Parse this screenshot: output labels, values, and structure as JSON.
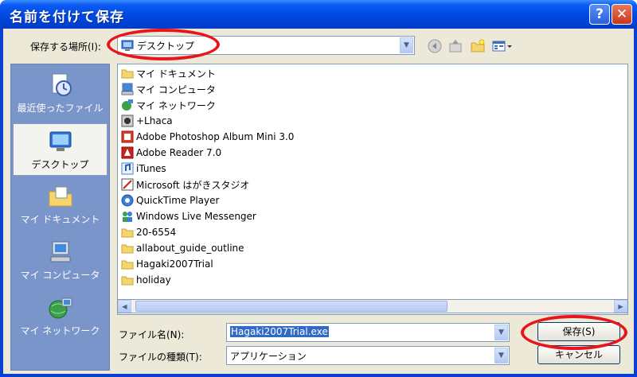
{
  "window": {
    "title": "名前を付けて保存"
  },
  "titlebar_buttons": {
    "help": "?",
    "close": "✕"
  },
  "location": {
    "label": "保存する場所(I):",
    "value": "デスクトップ"
  },
  "places": [
    {
      "label": "最近使ったファイル",
      "icon": "recent-files-icon"
    },
    {
      "label": "デスクトップ",
      "icon": "desktop-icon"
    },
    {
      "label": "マイ ドキュメント",
      "icon": "my-documents-icon"
    },
    {
      "label": "マイ コンピュータ",
      "icon": "my-computer-icon"
    },
    {
      "label": "マイ ネットワーク",
      "icon": "my-network-icon"
    }
  ],
  "files": [
    {
      "name": "マイ ドキュメント",
      "icon": "folder-docs-icon"
    },
    {
      "name": "マイ コンピュータ",
      "icon": "computer-icon"
    },
    {
      "name": "マイ ネットワーク",
      "icon": "network-icon"
    },
    {
      "name": "+Lhaca",
      "icon": "shortcut-icon"
    },
    {
      "name": "Adobe Photoshop Album Mini 3.0",
      "icon": "shortcut-icon"
    },
    {
      "name": "Adobe Reader 7.0",
      "icon": "shortcut-icon"
    },
    {
      "name": "iTunes",
      "icon": "shortcut-icon"
    },
    {
      "name": "Microsoft はがきスタジオ",
      "icon": "shortcut-icon"
    },
    {
      "name": "QuickTime Player",
      "icon": "shortcut-icon"
    },
    {
      "name": "Windows Live Messenger",
      "icon": "shortcut-icon"
    },
    {
      "name": "20-6554",
      "icon": "folder-icon"
    },
    {
      "name": "allabout_guide_outline",
      "icon": "folder-icon"
    },
    {
      "name": "Hagaki2007Trial",
      "icon": "folder-icon"
    },
    {
      "name": "holiday",
      "icon": "folder-icon"
    }
  ],
  "filename": {
    "label": "ファイル名(N):",
    "value": "Hagaki2007Trial.exe"
  },
  "filetype": {
    "label": "ファイルの種類(T):",
    "value": "アプリケーション"
  },
  "buttons": {
    "save": "保存(S)",
    "cancel": "キャンセル"
  },
  "colors": {
    "highlight_ring": "#e8161b",
    "titlebar": "#0048e0",
    "places_bar": "#7a95c9"
  }
}
